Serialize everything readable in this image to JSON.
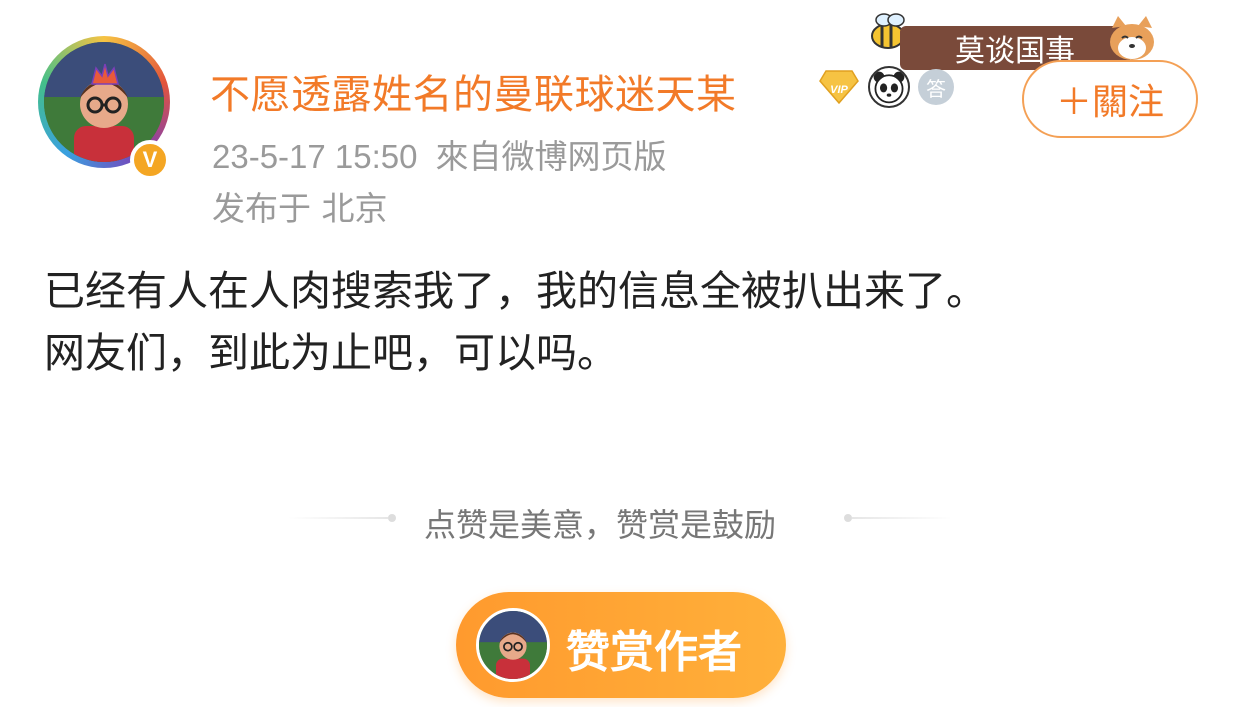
{
  "post": {
    "username": "不愿透露姓名的曼联球迷天某",
    "verified_mark": "V",
    "badge_answer": "答",
    "tag_banner": "莫谈国事",
    "follow_label": "＋關注",
    "timestamp": "23-5-17 15:50",
    "source": "來自微博网页版",
    "location": "发布于 北京",
    "body_lines": [
      "已经有人在人肉搜索我了，我的信息全被扒出来了。",
      "网友们，到此为止吧，可以吗。"
    ]
  },
  "reward": {
    "tip_text": "点赞是美意，赞赏是鼓励",
    "button_label": "赞赏作者"
  },
  "colors": {
    "accent_orange": "#f27a28",
    "meta_gray": "#9a9a9a",
    "reward_gradient_start": "#ff9a2e",
    "reward_gradient_end": "#ffb03a"
  },
  "icons": {
    "vip": "vip-diamond-icon",
    "panda": "panda-icon",
    "answer": "answer-badge-icon",
    "bee": "bee-icon",
    "dog": "shiba-dog-icon",
    "verified": "verified-icon"
  }
}
